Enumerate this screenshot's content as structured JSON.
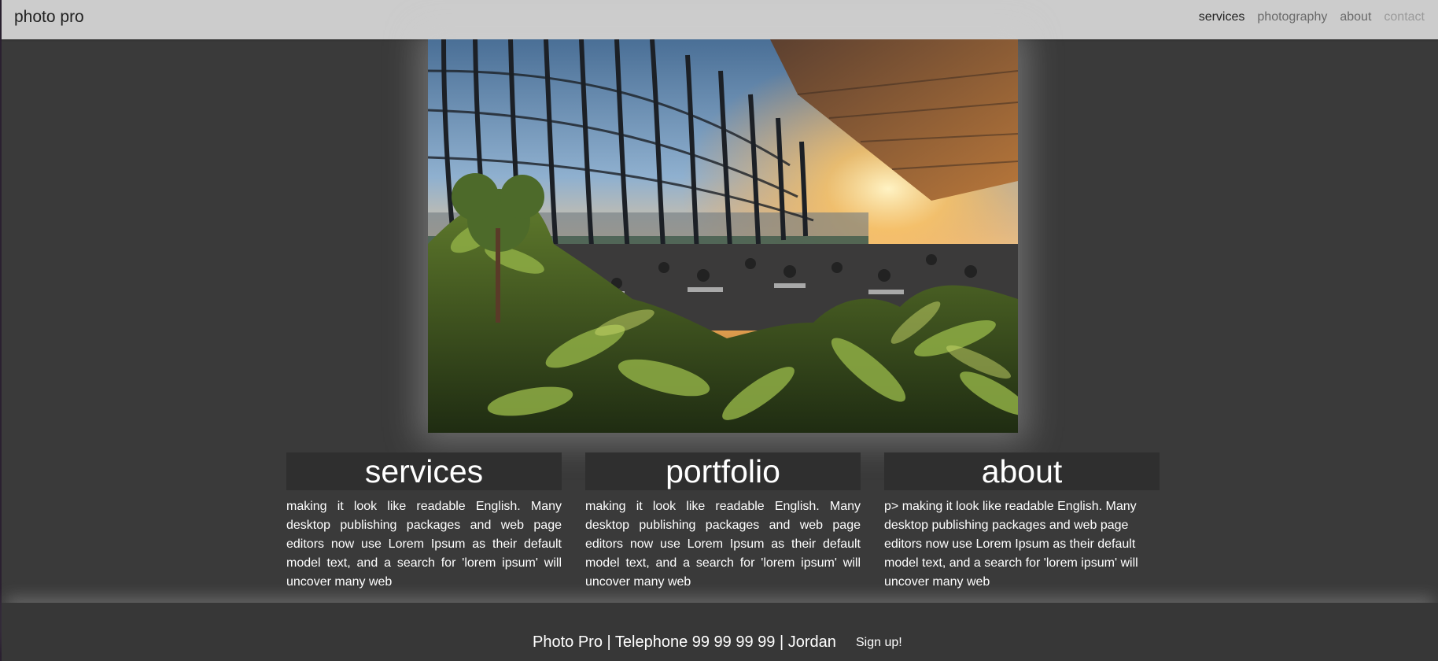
{
  "navbar": {
    "brand": "photo pro",
    "links": [
      {
        "label": "services"
      },
      {
        "label": "photography"
      },
      {
        "label": "about"
      },
      {
        "label": "contact"
      }
    ]
  },
  "hero": {
    "alt": "Sky garden interior with glass dome, plants and diners at sunset"
  },
  "columns": [
    {
      "heading": "services",
      "text": "making it look like readable English. Many desktop publishing packages and web page editors now use Lorem Ipsum as their default model text, and a search for 'lorem ipsum' will uncover many web"
    },
    {
      "heading": "portfolio",
      "text": "making it look like readable English. Many desktop publishing packages and web page editors now use Lorem Ipsum as their default model text, and a search for 'lorem ipsum' will uncover many web"
    },
    {
      "heading": "about",
      "text": "p> making it look like readable English. Many desktop publishing packages and web page editors now use Lorem Ipsum as their default model text, and a search for 'lorem ipsum' will uncover many web"
    }
  ],
  "footer": {
    "text": "Photo Pro | Telephone 99 99 99 99 | Jordan",
    "signup_label": "Sign up!"
  }
}
